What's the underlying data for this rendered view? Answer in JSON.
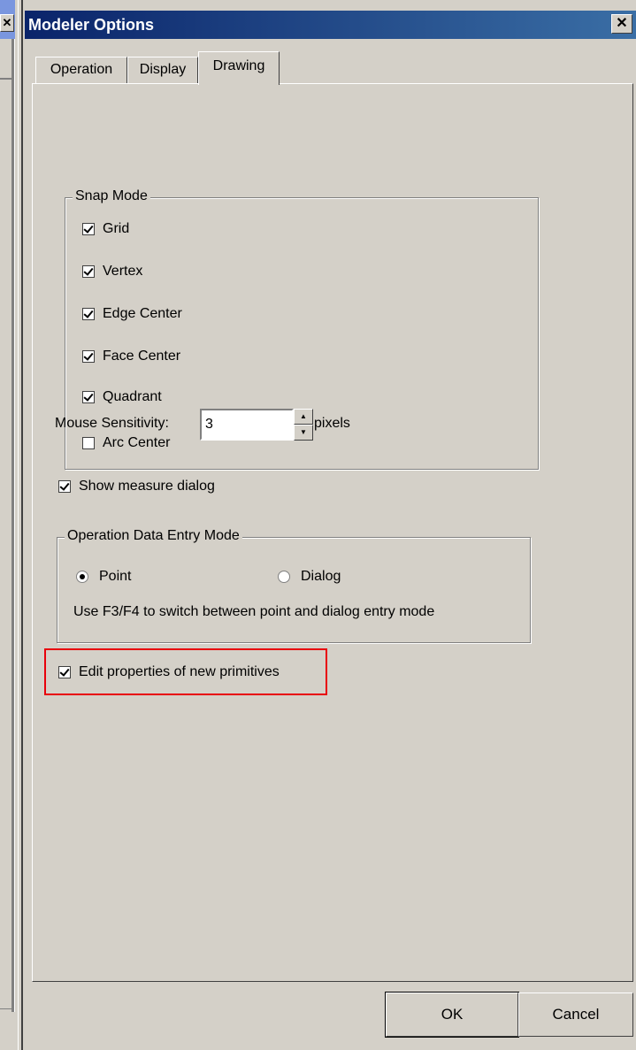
{
  "background_window": {
    "close_glyph": "✕"
  },
  "dialog": {
    "title": "Modeler Options",
    "close_glyph": "✕",
    "tabs": [
      {
        "label": "Operation",
        "active": false
      },
      {
        "label": "Display",
        "active": false
      },
      {
        "label": "Drawing",
        "active": true
      }
    ]
  },
  "snap_mode": {
    "label": "Snap Mode",
    "items": [
      {
        "label": "Grid",
        "checked": true
      },
      {
        "label": "Vertex",
        "checked": true
      },
      {
        "label": "Edge Center",
        "checked": true
      },
      {
        "label": "Face Center",
        "checked": true
      },
      {
        "label": "Quadrant",
        "checked": true
      },
      {
        "label": "Arc Center",
        "checked": false
      }
    ]
  },
  "mouse_sensitivity": {
    "label": "Mouse Sensitivity:",
    "value": "3",
    "unit": "pixels"
  },
  "show_measure": {
    "label": "Show measure dialog",
    "checked": true
  },
  "entry_mode": {
    "label": "Operation Data Entry Mode",
    "options": [
      {
        "label": "Point",
        "selected": true
      },
      {
        "label": "Dialog",
        "selected": false
      }
    ],
    "hint": "Use F3/F4 to switch between point and dialog entry mode"
  },
  "edit_properties": {
    "label": "Edit properties of new primitives",
    "checked": true
  },
  "buttons": {
    "ok": "OK",
    "cancel": "Cancel"
  },
  "colors": {
    "highlight": "#e8000b",
    "title_bar_start": "#0a246a",
    "dialog_bg": "#d4d0c8"
  }
}
